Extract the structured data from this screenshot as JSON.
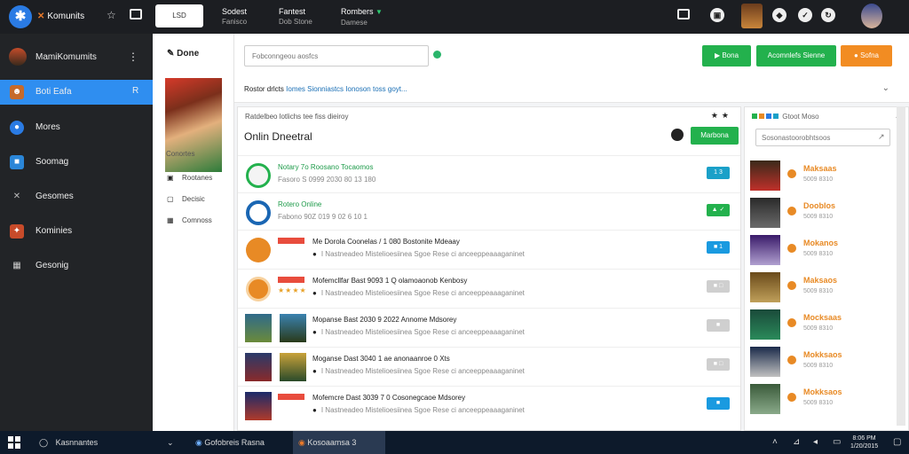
{
  "topbar": {
    "brand": "Komunits",
    "brand_mark": "✕",
    "pill": "LSD",
    "menus": [
      {
        "title": "Sodest",
        "sub": "Fanisco"
      },
      {
        "title": "Fantest",
        "sub": "Dob Stone"
      },
      {
        "title": "Rombers",
        "sub": "Damese"
      }
    ],
    "icons": [
      "mail-icon",
      "profile-card-icon",
      "shield-icon",
      "status-icon",
      "refresh-icon"
    ]
  },
  "sidebar": {
    "account": "MamiKomumits",
    "items": [
      {
        "label": "Boti Eafa",
        "icon": "avatar-icon",
        "active": true,
        "extra": "R"
      },
      {
        "label": "Mores",
        "icon": "circle-icon",
        "active": false
      },
      {
        "label": "Soomag",
        "icon": "square-icon",
        "active": false
      },
      {
        "label": "Gesomes",
        "icon": "cross-icon",
        "active": false
      },
      {
        "label": "Kominies",
        "icon": "puzzle-icon",
        "active": false
      },
      {
        "label": "Gesonig",
        "icon": "grid-icon",
        "active": false
      }
    ]
  },
  "leftcol": {
    "heading": "Done",
    "category": "Conortes",
    "links": [
      "Rootanes",
      "Decisic",
      "Comnoss"
    ]
  },
  "toolbar": {
    "search_placeholder": "Fobconngeou aosfcs",
    "buttons": [
      "Bona",
      "Acomnlefs Sienne",
      "Sofna"
    ],
    "hint_plain": "Rostor drlcts",
    "hint_link": "Iomes Sionniastcs Ionoson toss goyt..."
  },
  "content": {
    "crumb": "Ratdelbeo lotlichs tee fiss dieiroy",
    "title": "Onlin Dneetral",
    "action": "Marbona",
    "rows": [
      {
        "title": "Notary 7o Roosano Tocaomos",
        "sub": "Fasoro S 0999 2030 80 13 180",
        "badge": "1 3",
        "badge_color": "#1aa0c8",
        "title_color": "green"
      },
      {
        "title": "Rotero Online",
        "sub": "Fabono 90Z 019 9 02 6 10 1",
        "badge": "▲ ✓",
        "badge_color": "#23b14d",
        "title_color": "green"
      },
      {
        "title": "Me Dorola Coonelas / 1 080 Bostonite Mdeaay",
        "sub": "I Nastneadeo Mistelioesiinea Sgoe Rese ci anceeppeaaaganinet",
        "badge": "■ 1",
        "badge_color": "#1a9ae0"
      },
      {
        "title": "Mofemcllfar Bast 9093 1 Q olamoaonob Kenbosy",
        "sub": "I Nastneadeo Mistelioesiinea Sgoe Rese ci anceeppeaaaganinet",
        "badge": "■ □",
        "badge_color": "#c8c8c8"
      },
      {
        "title": "Mopanse Bast 2030 9 2022 Annome Mdsorey",
        "sub": "I Nastneadeo Mistelioesiinea Sgoe Rese ci anceeppeaaaganinet",
        "badge": "■",
        "badge_color": "#c8c8c8"
      },
      {
        "title": "Moganse Dast 3040 1 ae anonaanroe 0 Xts",
        "sub": "I Nastneadeo Mistelioesiinea Sgoe Rese ci anceeppeaaaganinet",
        "badge": "■ □",
        "badge_color": "#c8c8c8"
      },
      {
        "title": "Mofemcre Dast 3039 7 0 Cosonegcaoe Mdsorey",
        "sub": "I Nastneadeo Mistelioesiinea Sgoe Rese ci anceeppeaaaganinet",
        "badge": "■",
        "badge_color": "#1a9ae0"
      }
    ]
  },
  "rightpanel": {
    "head": "Gtoot Moso",
    "search_placeholder": "Sosonastoorobhtsoos",
    "items": [
      {
        "title": "Maksaas",
        "sub": "5009 8310"
      },
      {
        "title": "Dooblos",
        "sub": "5009 8310"
      },
      {
        "title": "Mokanos",
        "sub": "5009 8310"
      },
      {
        "title": "Maksaos",
        "sub": "5009 8310"
      },
      {
        "title": "Mocksaas",
        "sub": "5009 8310"
      },
      {
        "title": "Mokksaos",
        "sub": "5009 8310"
      },
      {
        "title": "Mokksaos",
        "sub": "5009 8310"
      }
    ]
  },
  "taskbar": {
    "search": "Kasnnantes",
    "apps": [
      "Gofobreis Rasna",
      "Kosoaamsa 3"
    ],
    "clock_time": "8:06 PM",
    "clock_date": "1/20/2015"
  }
}
